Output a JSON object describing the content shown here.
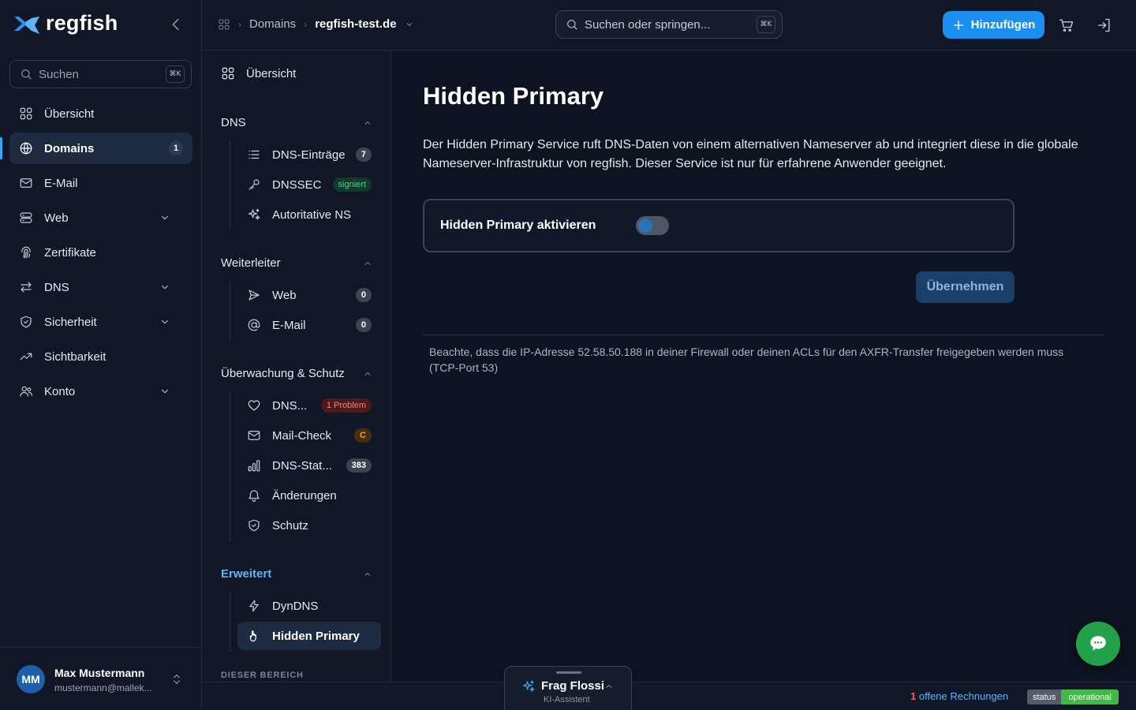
{
  "app": {
    "logo_text": "regfish"
  },
  "sidebar": {
    "search_placeholder": "Suchen",
    "search_shortcut": "⌘K",
    "items": [
      {
        "label": "Übersicht",
        "icon": "grid-icon"
      },
      {
        "label": "Domains",
        "icon": "globe-icon",
        "badge": "1",
        "active": true
      },
      {
        "label": "E-Mail",
        "icon": "mail-icon"
      },
      {
        "label": "Web",
        "icon": "server-icon",
        "expandable": true
      },
      {
        "label": "Zertifikate",
        "icon": "fingerprint-icon"
      },
      {
        "label": "DNS",
        "icon": "arrows-icon",
        "expandable": true
      },
      {
        "label": "Sicherheit",
        "icon": "shield-icon",
        "expandable": true
      },
      {
        "label": "Sichtbarkeit",
        "icon": "trend-icon"
      },
      {
        "label": "Konto",
        "icon": "users-icon",
        "expandable": true
      }
    ],
    "user": {
      "initials": "MM",
      "name": "Max Mustermann",
      "email": "mustermann@mallek..."
    }
  },
  "topbar": {
    "breadcrumb": {
      "section": "Domains",
      "current": "regfish-test.de"
    },
    "search_placeholder": "Suchen oder springen...",
    "search_shortcut": "⌘K",
    "add_label": "Hinzufügen"
  },
  "subnav": {
    "overview": "Übersicht",
    "sections": {
      "dns": {
        "title": "DNS",
        "items": [
          {
            "label": "DNS-Einträge",
            "badge": "7"
          },
          {
            "label": "DNSSEC",
            "badge": "signiert"
          },
          {
            "label": "Autoritative NS"
          }
        ]
      },
      "forwarders": {
        "title": "Weiterleiter",
        "items": [
          {
            "label": "Web",
            "badge": "0"
          },
          {
            "label": "E-Mail",
            "badge": "0"
          }
        ]
      },
      "monitoring": {
        "title": "Überwachung & Schutz",
        "items": [
          {
            "label": "DNS...",
            "badge": "1 Problem"
          },
          {
            "label": "Mail-Check",
            "badge": "C"
          },
          {
            "label": "DNS-Stat...",
            "badge": "383"
          },
          {
            "label": "Änderungen"
          },
          {
            "label": "Schutz"
          }
        ]
      },
      "advanced": {
        "title": "Erweitert",
        "items": [
          {
            "label": "DynDNS"
          },
          {
            "label": "Hidden Primary",
            "active": true
          }
        ]
      }
    },
    "footer_label": "DIESER BEREICH"
  },
  "main": {
    "title": "Hidden Primary",
    "description": "Der Hidden Primary Service ruft DNS-Daten von einem alternativen Nameserver ab und integriert diese in die globale Nameserver-Infrastruktur von regfish. Dieser Service ist nur für erfahrene Anwender geeignet.",
    "toggle_label": "Hidden Primary aktivieren",
    "toggle_on": false,
    "apply_label": "Übernehmen",
    "note": "Beachte, dass die IP-Adresse 52.58.50.188 in deiner Firewall oder deinen ACLs für den AXFR-Transfer freigegeben werden muss (TCP-Port 53)"
  },
  "bottombar": {
    "invoice_count": "1",
    "invoice_text": "offene Rechnungen",
    "status_label": "status",
    "status_value": "operational"
  },
  "assistant": {
    "title": "Frag Flossi",
    "subtitle": "KI-Assistent"
  },
  "colors": {
    "accent": "#1a8ff0",
    "chat": "#23a04a",
    "background": "#111726"
  }
}
